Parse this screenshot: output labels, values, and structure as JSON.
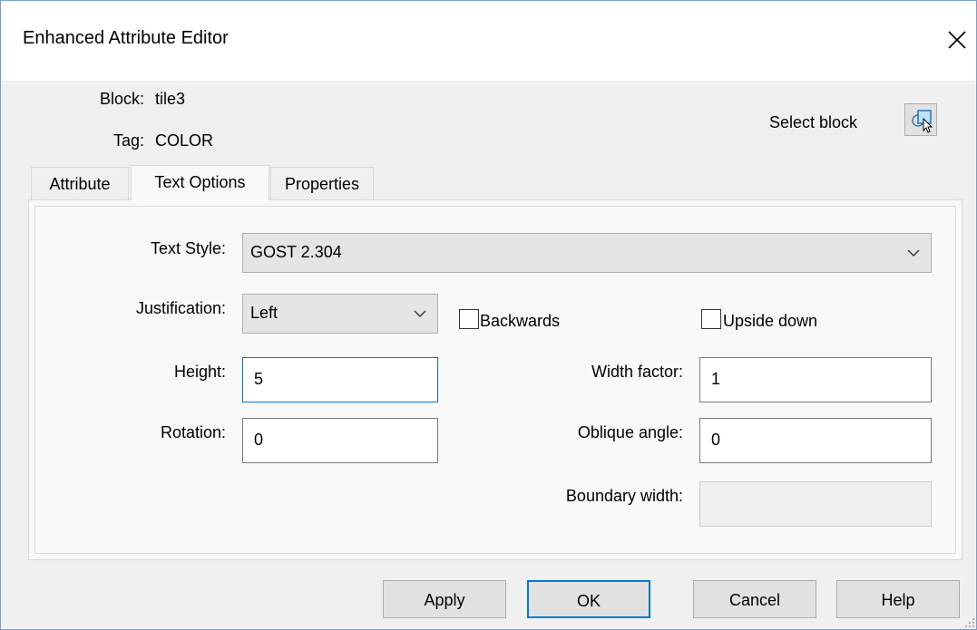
{
  "window": {
    "title": "Enhanced Attribute Editor"
  },
  "info": {
    "block_label": "Block:",
    "block_value": "tile3",
    "tag_label": "Tag:",
    "tag_value": "COLOR",
    "select_block_label": "Select block"
  },
  "tabs": [
    {
      "label": "Attribute",
      "active": false
    },
    {
      "label": "Text Options",
      "active": true
    },
    {
      "label": "Properties",
      "active": false
    }
  ],
  "form": {
    "text_style": {
      "label": "Text Style:",
      "value": "GOST 2.304"
    },
    "justification": {
      "label": "Justification:",
      "value": "Left"
    },
    "backwards": {
      "label": "Backwards",
      "checked": false
    },
    "upside_down": {
      "label": "Upside down",
      "checked": false
    },
    "height": {
      "label": "Height:",
      "value": "5"
    },
    "width_factor": {
      "label": "Width factor:",
      "value": "1"
    },
    "rotation": {
      "label": "Rotation:",
      "value": "0"
    },
    "oblique_angle": {
      "label": "Oblique angle:",
      "value": "0"
    },
    "boundary_width": {
      "label": "Boundary width:",
      "value": ""
    }
  },
  "buttons": {
    "apply": "Apply",
    "ok": "OK",
    "cancel": "Cancel",
    "help": "Help"
  },
  "colors": {
    "accent": "#0078d7",
    "border": "#adadad",
    "face": "#e1e1e1"
  }
}
